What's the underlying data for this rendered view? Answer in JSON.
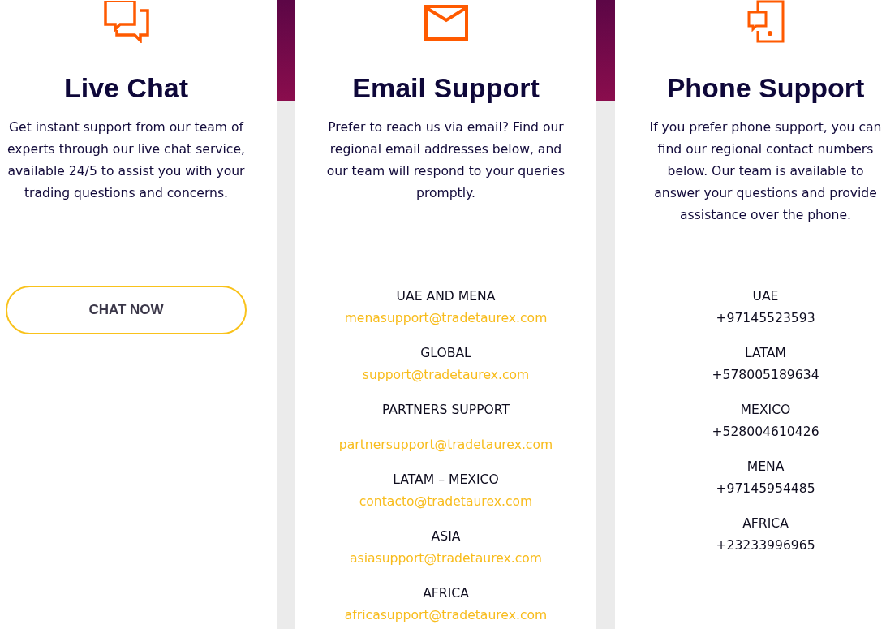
{
  "cards": [
    {
      "kind": "chat",
      "title": "Live Chat",
      "description": "Get instant support from our team of experts through our live chat service, available 24/5 to assist you with your trading questions and concerns.",
      "button": {
        "label": "CHAT NOW"
      }
    },
    {
      "kind": "email",
      "title": "Email Support",
      "description": "Prefer to reach us via email? Find our regional email addresses below, and our team will respond to your queries promptly.",
      "contacts": [
        {
          "kind": "plain",
          "region": "UAE AND MENA",
          "value": "menasupport@tradetaurex.com"
        },
        {
          "kind": "plain",
          "region": "GLOBAL",
          "value": "support@tradetaurex.com"
        },
        {
          "kind": "spaced",
          "region": "PARTNERS SUPPORT",
          "value": "partnersupport@tradetaurex.com"
        },
        {
          "kind": "plain",
          "region": "LATAM – MEXICO",
          "value": "contacto@tradetaurex.com"
        },
        {
          "kind": "plain",
          "region": "ASIA",
          "value": "asiasupport@tradetaurex.com"
        },
        {
          "kind": "plain",
          "region": "AFRICA",
          "value": "africasupport@tradetaurex.com"
        }
      ]
    },
    {
      "kind": "phone",
      "title": "Phone Support",
      "description": "If you prefer phone support, you can find our regional contact numbers below. Our team is available to answer your questions and provide assistance over the phone.",
      "contacts": [
        {
          "kind": "plain",
          "region": "UAE",
          "value": "+97145523593"
        },
        {
          "kind": "plain",
          "region": "LATAM",
          "value": "+578005189634"
        },
        {
          "kind": "plain",
          "region": "MEXICO",
          "value": "+528004610426"
        },
        {
          "kind": "plain",
          "region": "MENA",
          "value": "+97145954485"
        },
        {
          "kind": "plain",
          "region": "AFRICA",
          "value": "+23233996965"
        }
      ]
    }
  ]
}
